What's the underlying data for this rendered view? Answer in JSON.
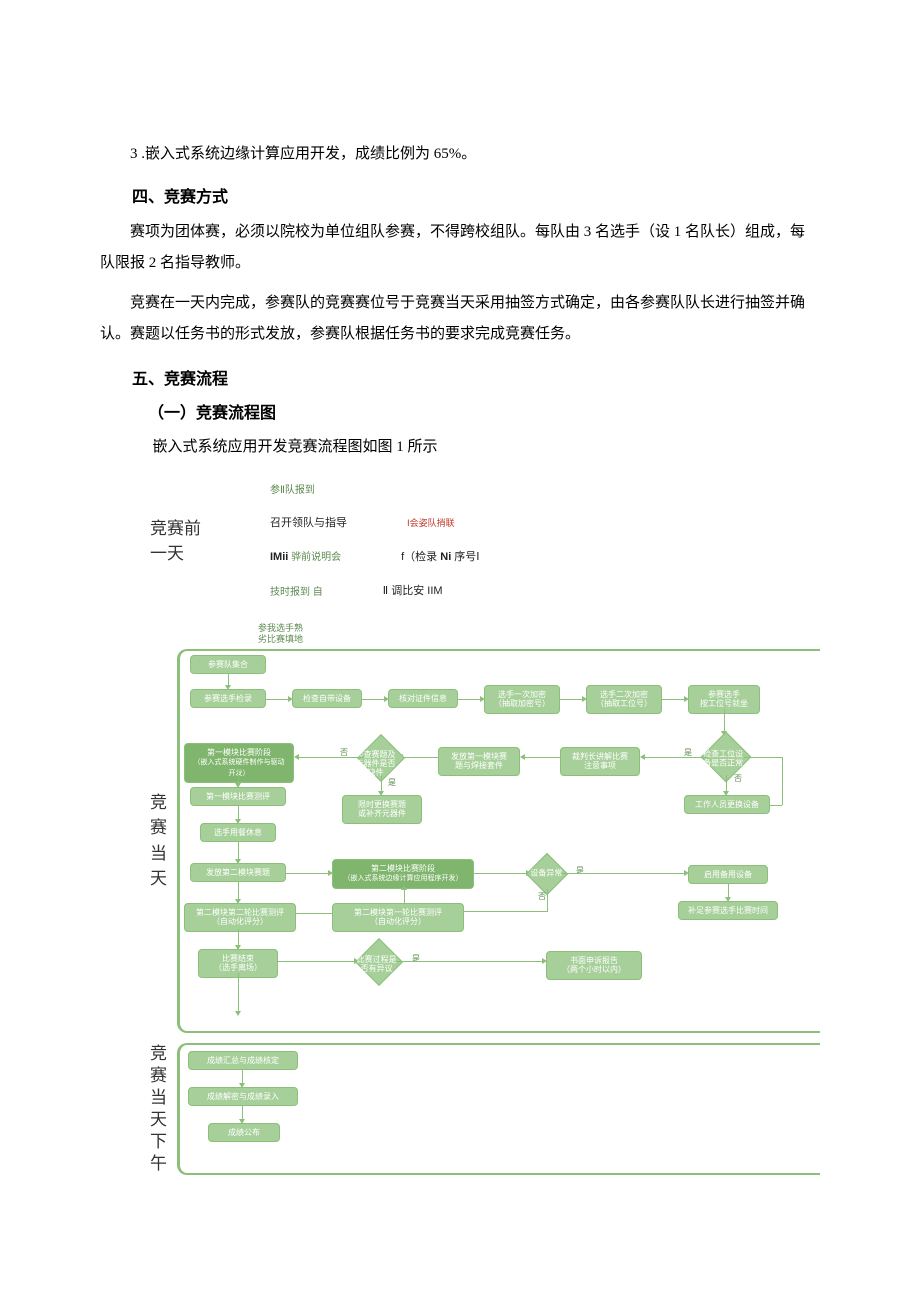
{
  "item3": {
    "num": "3",
    "text": " .嵌入式系统边缘计算应用开发，成绩比例为 ",
    "pct": "65%",
    "tail": "。"
  },
  "h4": "四、竞赛方式",
  "p1a": "赛项为团体赛，必须以院校为单位组队参赛，不得跨校组队。每队由 ",
  "p1b": " 名选手（设 ",
  "p1c": " 名队长）组成，每队限报 ",
  "p1d": " 名指导教师。",
  "n3": "3",
  "n1": "1",
  "n2": "2",
  "p2": "竞赛在一天内完成，参赛队的竞赛赛位号于竞赛当天采用抽签方式确定，由各参赛队队长进行抽签并确认。赛题以任务书的形式发放，参赛队根据任务书的要求完成竞赛任务。",
  "h5": "五、竞赛流程",
  "h5a": "（一）竞赛流程图",
  "capA": "嵌入式系统应用开发竞赛流程图如图 ",
  "capN": "1",
  "capB": " 所示",
  "phase1": "竞赛前一天",
  "phase2": "竞赛当天",
  "phase3": "竞 赛当 天下 午",
  "pre": {
    "r0": "参Ⅱ队报到",
    "r1a": "召开领队与指导",
    "r1b": "Ⅰ会姿队捎联",
    "r2a": "IMii",
    "r2b": " 骅前说明会",
    "r2c": "f（检录 ",
    "r2d": "Ni",
    "r2e": " 序号Ⅰ",
    "r3a": "技时报到   自",
    "r3b": "Ⅱ 调比安 IIM",
    "r4a": "参我选手熟",
    "r4b": "劣比赛填地"
  },
  "fc": {
    "n_gather": "参赛队集合",
    "n_checkin": "参赛选手检录",
    "n_checkdev": "检查自带设备",
    "n_verifyid": "核对证件信息",
    "n_enc1a": "选手一次加密",
    "n_enc1b": "（抽取加密号）",
    "n_enc2a": "选手二次加密",
    "n_enc2b": "（抽取工位号）",
    "n_seata": "参赛选手",
    "n_seatb": "按工位号就坐",
    "d_wsok": "检查工位设备是否正常",
    "n_staff": "工作人员更换设备",
    "n_judgea": "裁判长讲解比赛",
    "n_judgeb": "注意事项",
    "n_issue1a": "发放第一模块赛",
    "n_issue1b": "题与焊接套件",
    "d_titleok": "检查赛题及元器件是否缺件",
    "n_mod1a": "第一模块比赛阶段",
    "n_mod1b": "（嵌入式系统硬件制作与驱动开发）",
    "n_mod1eval": "第一模块比赛测评",
    "n_replacea": "限时更换赛题",
    "n_replaceb": "或补齐元器件",
    "n_rest": "选手用餐休息",
    "n_issue2": "发放第二模块赛题",
    "n_mod2a": "第二模块比赛阶段",
    "n_mod2b": "（嵌入式系统边缘计算应用程序开发）",
    "d_devfault": "设备异常",
    "n_backup": "启用备用设备",
    "n_comptime": "补足参赛选手比赛时间",
    "n_auto1a": "第二模块第一轮比赛测评",
    "n_auto1b": "（自动化评分）",
    "n_auto2a": "第二模块第二轮比赛测评",
    "n_auto2b": "（自动化评分）",
    "n_enda": "比赛结束",
    "n_endb": "（选手离场）",
    "d_dispute": "比赛过程是否有异议",
    "n_appeala": "书面申诉报告",
    "n_appealb": "（两个小时以内）",
    "n_score1": "成绩汇总与成绩核定",
    "n_score2": "成绩解密与成绩录入",
    "n_score3": "成绩公布",
    "yes": "是",
    "no": "否"
  }
}
